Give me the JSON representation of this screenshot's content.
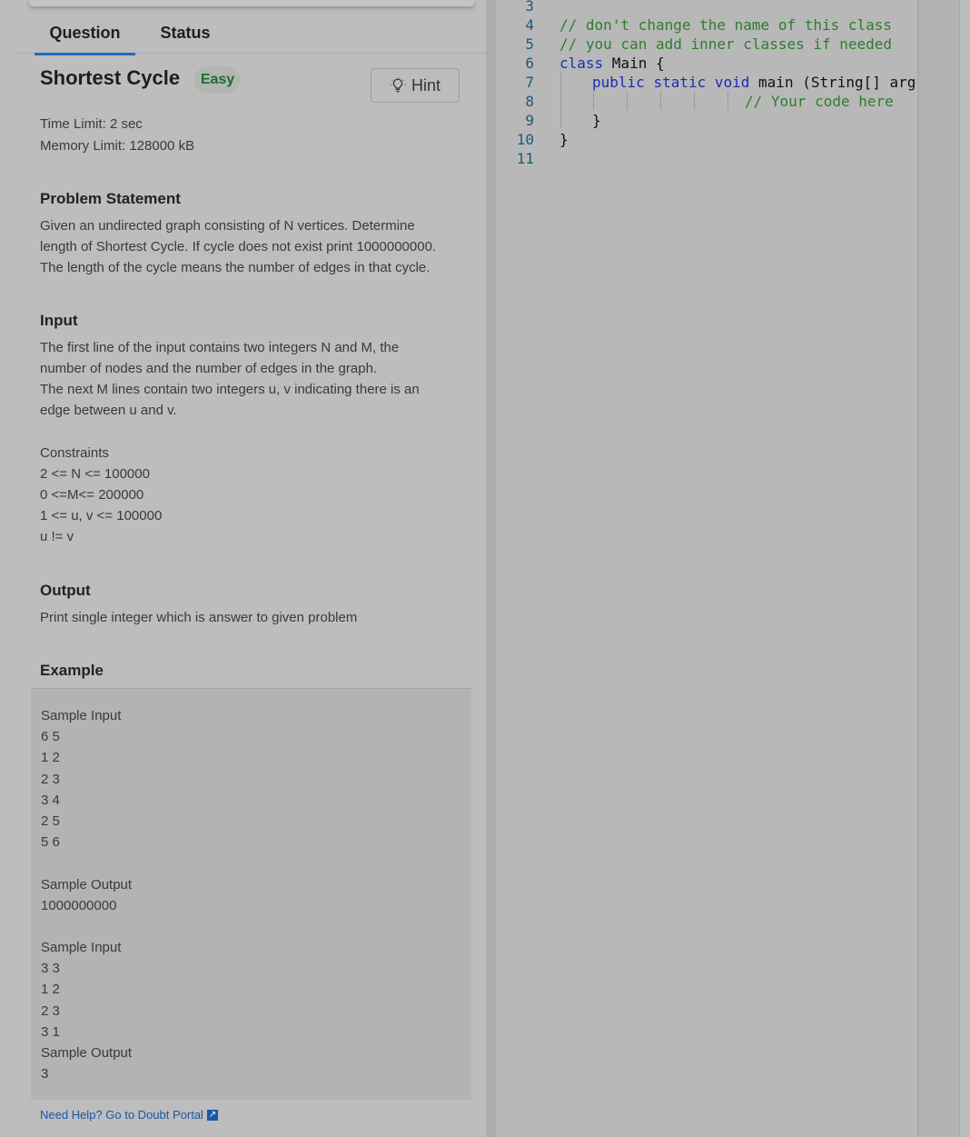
{
  "tabs": {
    "question": "Question",
    "status": "Status"
  },
  "problem": {
    "title": "Shortest Cycle",
    "difficulty": "Easy",
    "hint_label": "Hint",
    "time_limit": "Time Limit: 2 sec",
    "memory_limit": "Memory Limit: 128000 kB",
    "statement_heading": "Problem Statement",
    "statement": [
      "Given an undirected graph consisting of N vertices. Determine",
      "length of Shortest Cycle. If cycle does not exist print 1000000000.",
      "The length of the cycle means the number of edges in that cycle."
    ],
    "input_heading": "Input",
    "input": [
      "The first line of the input contains two integers N and M, the",
      "number of nodes and the number of edges in the graph.",
      "The next M lines contain two integers u, v indicating there is an",
      "edge between u and v."
    ],
    "constraints_heading": "Constraints",
    "constraints": [
      "2 <= N <= 100000",
      "0 <=M<= 200000",
      "1 <= u, v <= 100000",
      "u != v"
    ],
    "output_heading": "Output",
    "output": "Print single integer which is answer to given problem",
    "example_heading": "Example",
    "example_lines": [
      "Sample Input",
      "6 5",
      "1 2",
      "2 3",
      "3 4",
      "2 5",
      "5 6",
      "",
      "Sample Output",
      "1000000000",
      "",
      "Sample Input",
      "3 3",
      "1 2",
      "2 3",
      "3 1",
      "Sample Output",
      "3"
    ],
    "help_link": "Need Help? Go to Doubt Portal"
  },
  "editor": {
    "line_numbers": [
      "3",
      "4",
      "5",
      "6",
      "7",
      "8",
      "9",
      "10",
      "11"
    ],
    "lines": {
      "l4": "// don't change the name of this class",
      "l5": "// you can add inner classes if needed",
      "l6_kw": "class",
      "l6_rest": " Main {",
      "l7_kw1": "public",
      "l7_kw2": "static",
      "l7_kw3": "void",
      "l7_rest": " main (String[] args)",
      "l8": "// Your code here",
      "l9": "}",
      "l10": "}"
    }
  }
}
